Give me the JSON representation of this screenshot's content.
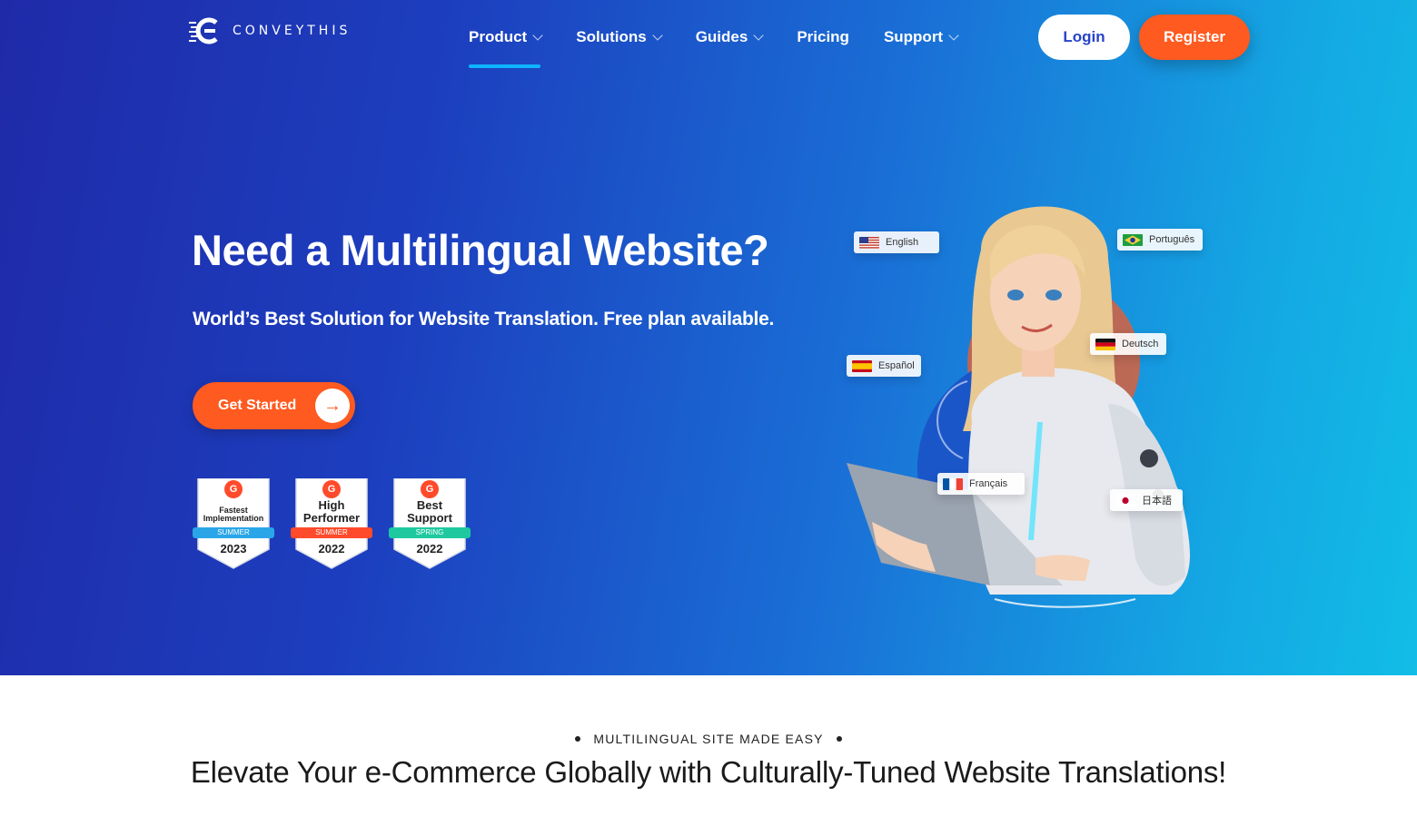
{
  "brand": {
    "name": "CONVEYTHIS",
    "logo_icon": "conveythis-logo-icon"
  },
  "nav": {
    "items": [
      {
        "label": "Product",
        "has_dropdown": true,
        "active": true
      },
      {
        "label": "Solutions",
        "has_dropdown": true
      },
      {
        "label": "Guides",
        "has_dropdown": true
      },
      {
        "label": "Pricing",
        "has_dropdown": false
      },
      {
        "label": "Support",
        "has_dropdown": true
      }
    ],
    "login_label": "Login",
    "register_label": "Register"
  },
  "hero": {
    "title": "Need a Multilingual Website?",
    "subtitle": "World’s Best Solution for Website Translation. Free plan available.",
    "cta_label": "Get Started",
    "cta_icon": "arrow-right-icon"
  },
  "badges": [
    {
      "title_lines": [
        "Fastest",
        "Implementation"
      ],
      "season": "SUMMER",
      "year": "2023",
      "ribbon_color": "#2aa6e8"
    },
    {
      "title_lines": [
        "High",
        "Performer"
      ],
      "season": "SUMMER",
      "year": "2022",
      "ribbon_color": "#ff4b2b"
    },
    {
      "title_lines": [
        "Best",
        "Support"
      ],
      "season": "SPRING",
      "year": "2022",
      "ribbon_color": "#1ec9a0"
    }
  ],
  "languages": [
    "English",
    "Português",
    "Deutsch",
    "Español",
    "Français",
    "日本語"
  ],
  "section": {
    "eyebrow": "MULTILINGUAL SITE MADE EASY",
    "heading": "Elevate Your e-Commerce Globally with Culturally-Tuned Website Translations!"
  },
  "colors": {
    "accent_orange": "#ff5a1f",
    "link_blue": "#2743c9",
    "nav_underline": "#0fb4ff"
  }
}
